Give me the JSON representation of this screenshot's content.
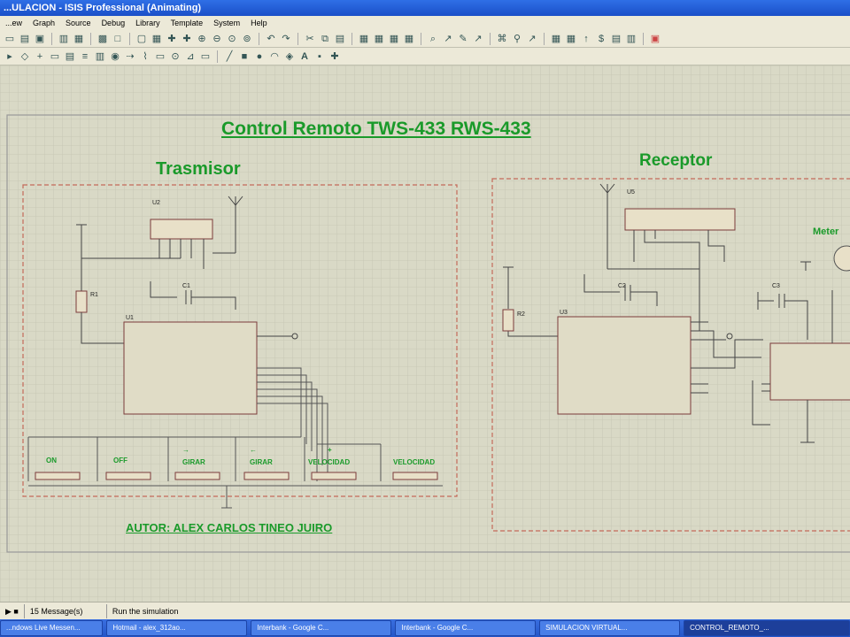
{
  "window": {
    "title": "...ULACION - ISIS Professional (Animating)"
  },
  "menu": [
    "...ew",
    "Graph",
    "Source",
    "Debug",
    "Library",
    "Template",
    "System",
    "Help"
  ],
  "schematic": {
    "main_title": "Control Remoto TWS-433   RWS-433",
    "transmitter_title": "Trasmisor",
    "receiver_title": "Receptor",
    "author": "AUTOR: ALEX CARLOS TINEO JUIRO",
    "meter_label": "Meter",
    "parts": {
      "u2": "U2",
      "u1": "U1",
      "r1": "R1",
      "c1": "C1",
      "u5": "U5",
      "u3": "U3",
      "r2": "R2",
      "c2": "C2",
      "c3": "C3"
    },
    "buttons": [
      "ON",
      "OFF",
      "GIRAR",
      "GIRAR",
      "VELOCIDAD",
      "VELOCIDAD"
    ],
    "button_symbols": [
      "",
      "",
      "→",
      "←",
      "+",
      ""
    ]
  },
  "status": {
    "messages": "15 Message(s)",
    "hint": "Run the simulation"
  },
  "taskbar": [
    "...ndows Live Messen...",
    "Hotmail - alex_312ao...",
    "Interbank - Google C...",
    "Interbank - Google C...",
    "SIMULACION VIRTUAL...",
    "CONTROL_REMOTO_..."
  ]
}
